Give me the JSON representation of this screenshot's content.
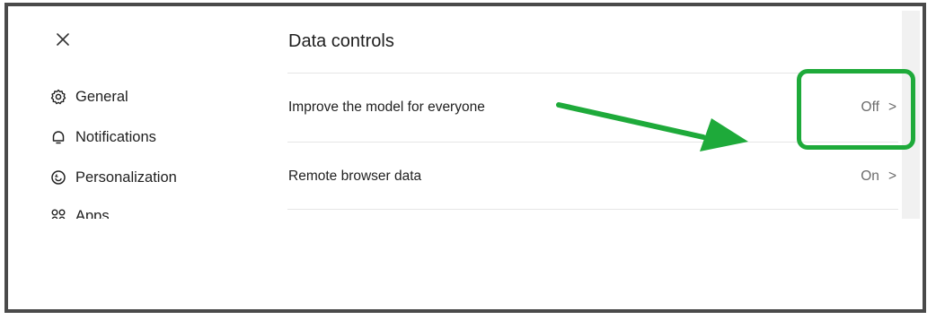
{
  "close": {
    "icon": "close-icon",
    "symbol": "×"
  },
  "sidebar": {
    "items": [
      {
        "label": "General",
        "icon": "gear-icon"
      },
      {
        "label": "Notifications",
        "icon": "bell-icon"
      },
      {
        "label": "Personalization",
        "icon": "personalization-icon"
      },
      {
        "label": "Apps",
        "icon": "apps-icon"
      }
    ]
  },
  "main": {
    "title": "Data controls",
    "rows": [
      {
        "label": "Improve the model for everyone",
        "value": "Off",
        "chevron": ">"
      },
      {
        "label": "Remote browser data",
        "value": "On",
        "chevron": ">"
      }
    ]
  },
  "annotation": {
    "color": "#1eaa3a"
  }
}
